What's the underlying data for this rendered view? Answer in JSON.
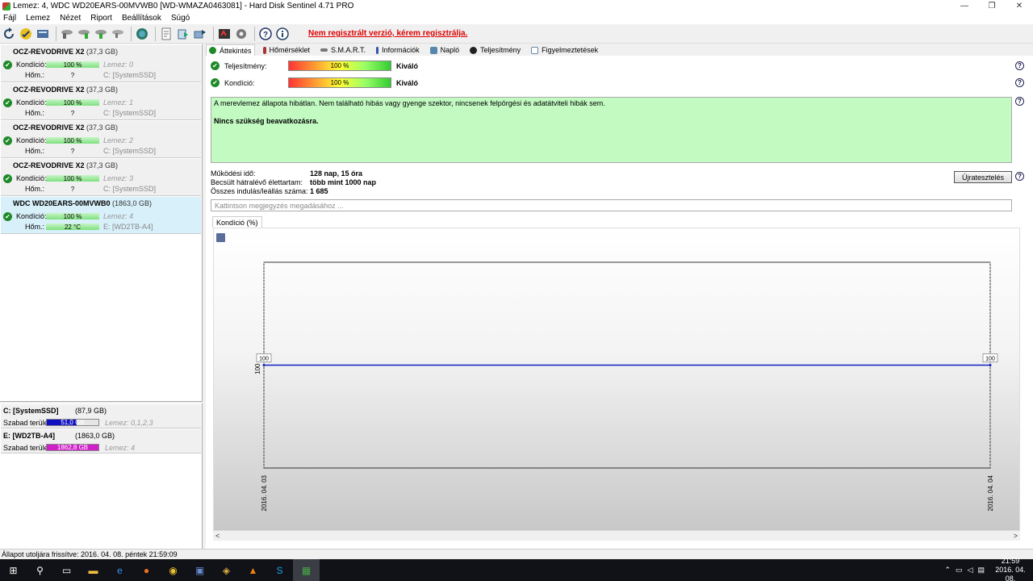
{
  "window": {
    "title": "Lemez: 4, WDC WD20EARS-00MVWB0 [WD-WMAZA0463081]  -  Hard Disk Sentinel 4.71 PRO",
    "controls": [
      "—",
      "❐",
      "✕"
    ]
  },
  "menu": [
    "Fájl",
    "Lemez",
    "Nézet",
    "Riport",
    "Beállítások",
    "Súgó"
  ],
  "toolbar": {
    "icons": [
      "refresh-icon",
      "health-icon",
      "disk-icon",
      "disk-settings-icon",
      "disk-test-icon",
      "disk-erase-icon",
      "disk-wipe-icon",
      "globe-icon",
      "report-icon",
      "copy-report-icon",
      "send-report-icon",
      "firewire-icon",
      "gear-icon",
      "help-icon",
      "info-icon"
    ],
    "register_notice": "Nem regisztrált verzió, kérem regisztrálja."
  },
  "disks": [
    {
      "name": "OCZ-REVODRIVE X2",
      "size": "(37,3 GB)",
      "kond_label": "Kondíció:",
      "kond_value": "100 %",
      "disk_no": "Lemez: 0",
      "hom_label": "Hőm.:",
      "hom_value": "?",
      "volume": "C: [SystemSSD]"
    },
    {
      "name": "OCZ-REVODRIVE X2",
      "size": "(37,3 GB)",
      "kond_label": "Kondíció:",
      "kond_value": "100 %",
      "disk_no": "Lemez: 1",
      "hom_label": "Hőm.:",
      "hom_value": "?",
      "volume": "C: [SystemSSD]"
    },
    {
      "name": "OCZ-REVODRIVE X2",
      "size": "(37,3 GB)",
      "kond_label": "Kondíció:",
      "kond_value": "100 %",
      "disk_no": "Lemez: 2",
      "hom_label": "Hőm.:",
      "hom_value": "?",
      "volume": "C: [SystemSSD]"
    },
    {
      "name": "OCZ-REVODRIVE X2",
      "size": "(37,3 GB)",
      "kond_label": "Kondíció:",
      "kond_value": "100 %",
      "disk_no": "Lemez: 3",
      "hom_label": "Hőm.:",
      "hom_value": "?",
      "volume": "C: [SystemSSD]"
    },
    {
      "name": "WDC WD20EARS-00MVWB0",
      "size": "(1863,0 GB)",
      "kond_label": "Kondíció:",
      "kond_value": "100 %",
      "disk_no": "Lemez: 4",
      "hom_label": "Hőm.:",
      "hom_value": "22 °C",
      "volume": "E: [WD2TB-A4]"
    }
  ],
  "volumes": [
    {
      "name": "C: [SystemSSD]",
      "size": "(87,9 GB)",
      "free_label": "Szabad terület",
      "free_value": "51,0 GB",
      "free_fraction": 0.58,
      "bar_color": "#1010c0",
      "disks": "Lemez: 0,1,2,3"
    },
    {
      "name": "E: [WD2TB-A4]",
      "size": "(1863,0 GB)",
      "free_label": "Szabad terület",
      "free_value": "1862,8 GB",
      "free_fraction": 1.0,
      "bar_color": "#d020c8",
      "disks": "Lemez: 4"
    }
  ],
  "tabs": [
    {
      "label": "Áttekintés",
      "color": "#1f8a2a"
    },
    {
      "label": "Hőmérséklet",
      "color": "#a33"
    },
    {
      "label": "S.M.A.R.T.",
      "color": "#777"
    },
    {
      "label": "Információk",
      "color": "#35a"
    },
    {
      "label": "Napló",
      "color": "#58a"
    },
    {
      "label": "Teljesítmény",
      "color": "#222"
    },
    {
      "label": "Figyelmeztetések",
      "color": "#68a"
    }
  ],
  "overview": {
    "perf_label": "Teljesítmény:",
    "perf_value": "100 %",
    "perf_rating": "Kiváló",
    "cond_label": "Kondíció:",
    "cond_value": "100 %",
    "cond_rating": "Kiváló",
    "status_text": "A merevlemez állapota hibátlan. Nem található hibás vagy gyenge szektor, nincsenek felpörgési és adatátviteli hibák sem.",
    "status_action": "Nincs szükség beavatkozásra.",
    "uptime_label": "Működési idő:",
    "uptime_value": "128 nap, 15 óra",
    "remaining_label": "Becsült hátralévő élettartam:",
    "remaining_value": "több mint 1000 nap",
    "starts_label": "Összes indulás/leállás száma:",
    "starts_value": "1 685",
    "retest_button": "Újratesztelés",
    "note_placeholder": "Kattintson megjegyzés megadásához ..."
  },
  "chart_tab": "Kondíció  (%)",
  "chart_data": {
    "type": "line",
    "x": [
      "2016. 04. 03",
      "2016. 04. 04"
    ],
    "series": [
      {
        "values": [
          100,
          100
        ]
      }
    ],
    "data_labels": [
      "100",
      "100"
    ],
    "ytick": "100",
    "color": "#1020c0"
  },
  "statusbar": "Állapot utoljára frissítve: 2016. 04. 08. péntek 21:59:09",
  "taskbar": {
    "apps": [
      "start-icon",
      "search-icon",
      "task-view-icon",
      "file-explorer-icon",
      "edge-icon",
      "firefox-icon",
      "chrome-icon",
      "save-app-icon",
      "tools-app-icon",
      "vlc-icon",
      "skype-icon",
      "hdsentinel-icon"
    ],
    "time": "21:59",
    "date": "2016. 04. 08."
  }
}
